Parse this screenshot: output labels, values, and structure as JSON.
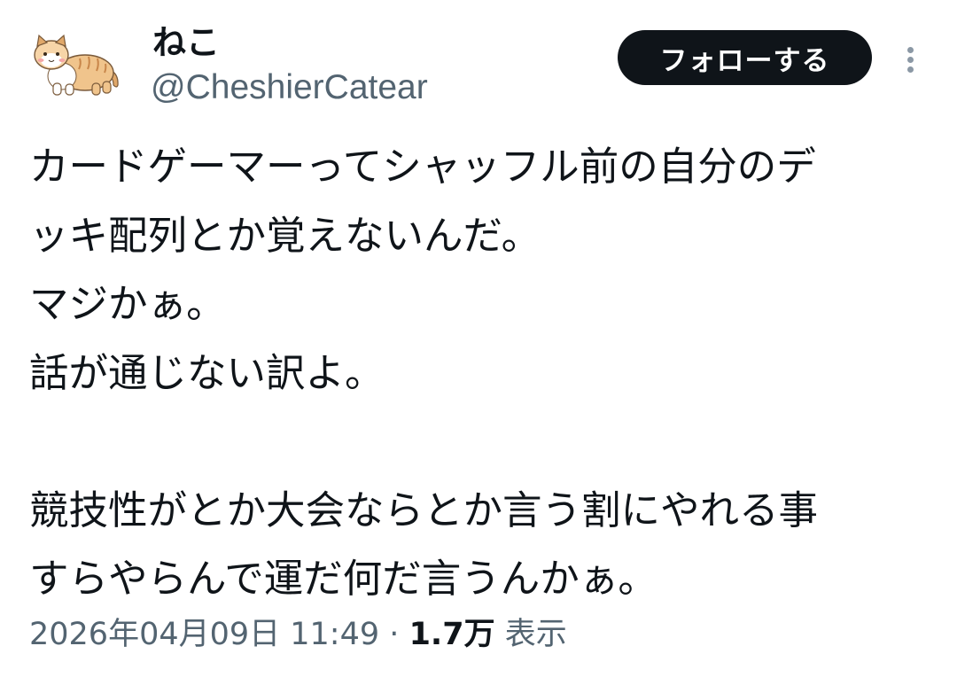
{
  "author": {
    "name": "ねこ",
    "handle": "@CheshierCatear"
  },
  "follow_button": {
    "label": "フォローする"
  },
  "tweet": {
    "lines": [
      "カードゲーマーってシャッフル前の自分のデ",
      "ッキ配列とか覚えないんだ。",
      "マジかぁ。",
      "話が通じない訳よ。",
      "",
      "競技性がとか大会ならとか言う割にやれる事",
      "すらやらんで運だ何だ言うんかぁ。"
    ]
  },
  "meta": {
    "timestamp": "2026年04月09日 11:49",
    "separator": "·",
    "views_count": "1.7万",
    "views_label": "表示"
  },
  "icons": {
    "avatar": "cat-illustration",
    "more": "more-vertical-icon"
  },
  "colors": {
    "text_primary": "#0f1419",
    "text_secondary": "#536471",
    "button_bg": "#0f1419",
    "button_text": "#ffffff"
  }
}
